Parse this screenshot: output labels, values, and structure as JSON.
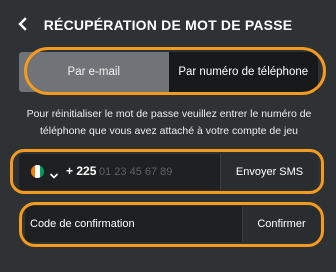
{
  "header": {
    "title": "RÉCUPÉRATION DE MOT DE PASSE",
    "back_icon": "chevron-left-icon"
  },
  "tabs": [
    {
      "label": "Par e-mail",
      "active": true
    },
    {
      "label": "Par numéro de téléphone",
      "active": false
    }
  ],
  "instructions": "Pour réinitialiser le mot de passe veuillez entrer le numéro de téléphone que vous avez attaché à votre compte de jeu",
  "phone": {
    "country_flag": "ivory-coast-flag-icon",
    "dial_code": "+ 225",
    "placeholder": "01 23 45 67 89",
    "send_button": "Envoyer SMS"
  },
  "confirmation": {
    "placeholder": "Code de confirmation",
    "confirm_button": "Confirmer"
  },
  "colors": {
    "background": "#2f3234",
    "highlight": "#f39a1f",
    "tab_active": "#707377",
    "field_bg": "#1e2021"
  }
}
